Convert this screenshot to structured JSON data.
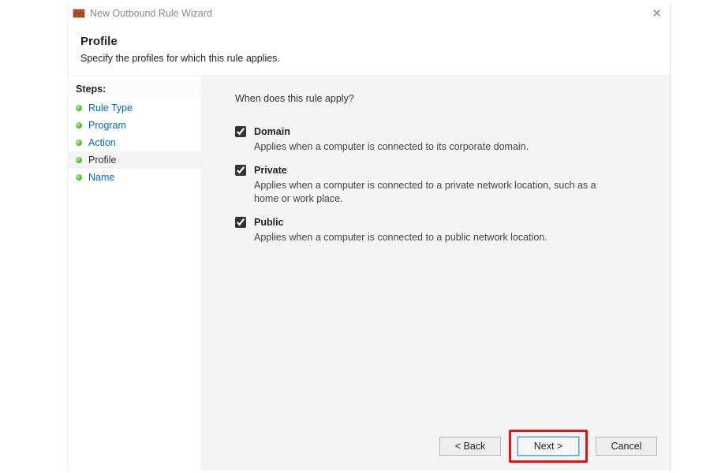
{
  "window": {
    "title": "New Outbound Rule Wizard"
  },
  "header": {
    "heading": "Profile",
    "subtitle": "Specify the profiles for which this rule applies."
  },
  "sidebar": {
    "steps_label": "Steps:",
    "items": [
      {
        "label": "Rule Type",
        "current": false
      },
      {
        "label": "Program",
        "current": false
      },
      {
        "label": "Action",
        "current": false
      },
      {
        "label": "Profile",
        "current": true
      },
      {
        "label": "Name",
        "current": false
      }
    ]
  },
  "main": {
    "prompt": "When does this rule apply?",
    "options": [
      {
        "key": "domain",
        "label": "Domain",
        "checked": true,
        "desc": "Applies when a computer is connected to its corporate domain."
      },
      {
        "key": "private",
        "label": "Private",
        "checked": true,
        "desc": "Applies when a computer is connected to a private network location, such as a home or work place."
      },
      {
        "key": "public",
        "label": "Public",
        "checked": true,
        "desc": "Applies when a computer is connected to a public network location."
      }
    ]
  },
  "footer": {
    "back": "< Back",
    "next": "Next >",
    "cancel": "Cancel"
  }
}
